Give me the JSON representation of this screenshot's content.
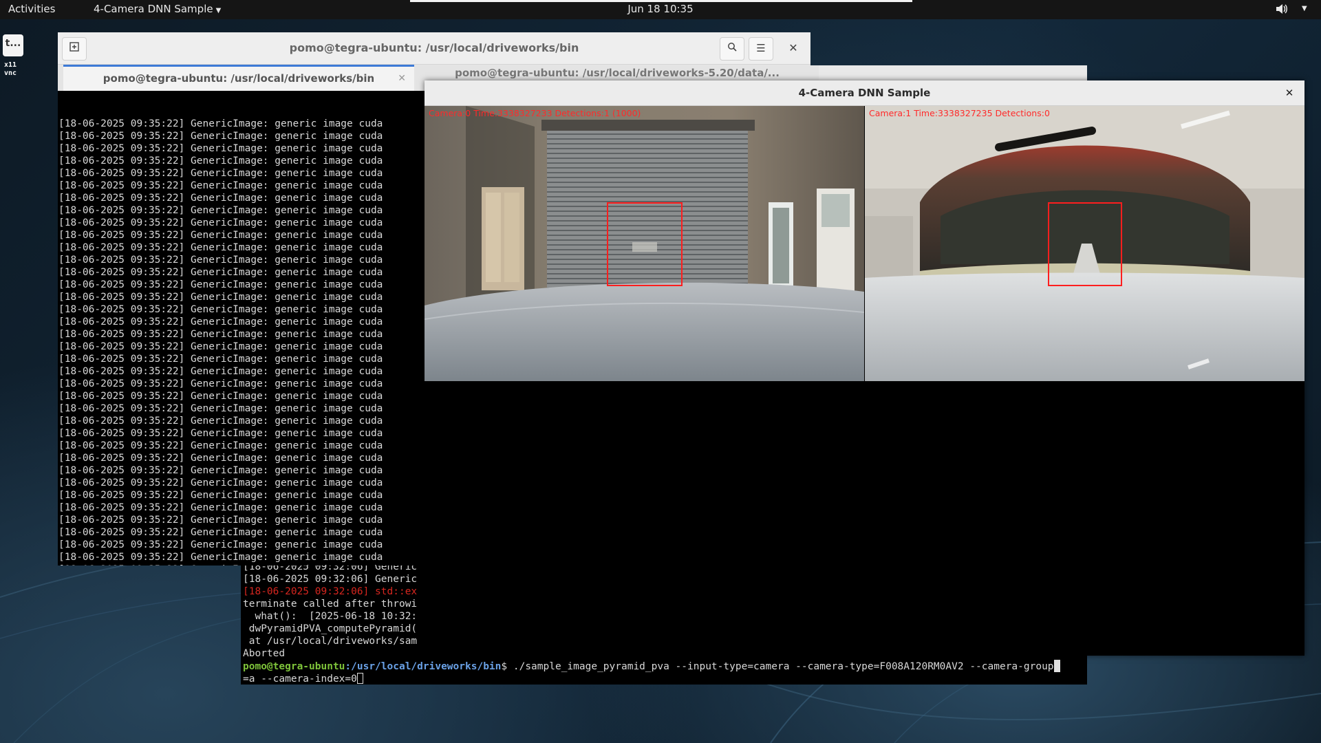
{
  "topbar": {
    "activities": "Activities",
    "app_menu": "4-Camera DNN Sample",
    "clock": "Jun 18  10:35"
  },
  "dock": {
    "tile_label": "t...",
    "vnc_label_1": "x11",
    "vnc_label_2": "vnc"
  },
  "terminal_front": {
    "title": "pomo@tegra-ubuntu: /usr/local/driveworks/bin",
    "tabs": [
      {
        "label": "pomo@tegra-ubuntu: /usr/local/driveworks/bin",
        "active": true
      },
      {
        "label": "pomo@tegra-ubuntu: /usr/local/driveworks-5.20/data/...",
        "active": false
      }
    ],
    "log_line": "[18-06-2025 09:35:22] GenericImage: generic image cuda",
    "log_count": 37
  },
  "terminal_back": {
    "lines": [
      "[18-06-2025 09:32:06] Generic",
      "[18-06-2025 09:32:06] Generic",
      "[18-06-2025 09:32:06] std::ex",
      "terminate called after throwi",
      "  what():  [2025-06-18 10:32:",
      " dwPyramidPVA_computePyramid(",
      " at /usr/local/driveworks/sam",
      "Aborted"
    ],
    "prompt_user": "pomo@tegra-ubuntu",
    "prompt_path": ":/usr/local/driveworks/bin",
    "prompt_symbol": "$",
    "command_line1": " ./sample_image_pyramid_pva --input-type=camera --camera-type=F008A120RM0AV2 --camera-group",
    "command_line2": "=a --camera-index=0"
  },
  "dnn_window": {
    "title": "4-Camera DNN Sample",
    "cameras": [
      {
        "label": "Camera:0 Time:3338327233 Detections:1 (1000)"
      },
      {
        "label": "Camera:1 Time:3338327235 Detections:0"
      }
    ]
  },
  "colors": {
    "accent_tab": "#3d7ad6",
    "detection_box": "#ff1e1e",
    "prompt_user": "#7ec33a",
    "prompt_path": "#6aa1e6",
    "error_text": "#d7261f"
  }
}
